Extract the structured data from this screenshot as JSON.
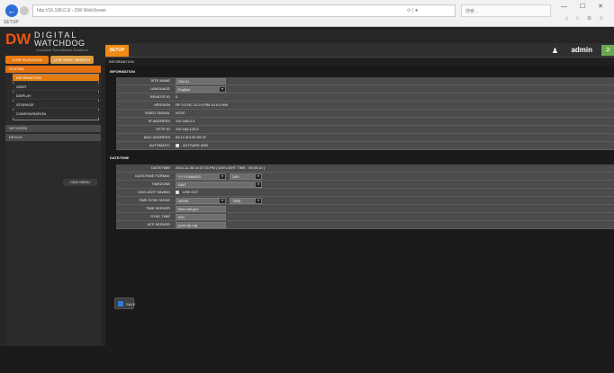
{
  "browser": {
    "address": "http://16.168.0.3/ - DW WebViewer",
    "addr_controls": "⟳ | ★",
    "search": "搜索...",
    "tab": "SETUP",
    "window_buttons": "— ☐ ✕",
    "tools": "⌂ ☆ ⚙ ☺"
  },
  "logo": {
    "mark": "DW",
    "line1": "DIGITAL",
    "line2": "WATCHDOG",
    "tagline": "Complete Surveillance Solutions"
  },
  "top": {
    "setup_tab": "SETUP",
    "user": "admin",
    "user_icon": "person-icon",
    "logout_icon": "exit-icon"
  },
  "left_tabs": [
    "CONFIGURATION",
    "LIVE VIEW / SEARCH"
  ],
  "sidebar": {
    "system": "SYSTEM",
    "items": [
      "INFORMATION",
      "USER",
      "DISPLAY",
      "STORAGE",
      "CONFIGURATION"
    ],
    "gray1": "NETWORK",
    "gray2": "DEVICE",
    "hide_menu": "HIDE MENU"
  },
  "main": {
    "breadcrumb": "INFORMATION",
    "info_title": "INFORMATION",
    "info_rows": [
      {
        "label": "SITE NAME",
        "value": "DW-01"
      },
      {
        "label": "LANGUAGE",
        "value": "English"
      },
      {
        "label": "REMOTE ID",
        "value": "0"
      },
      {
        "label": "VERSION",
        "value": "RF 0.0 RC 11.0.0 RM 16.0.0 HW"
      },
      {
        "label": "VIDEO SIGNAL",
        "value": "NTSC"
      },
      {
        "label": "IP ADDRESS",
        "value": "192.168.0.3"
      },
      {
        "label": "HTTP ID",
        "value": "192.168.123.5"
      },
      {
        "label": "MAC ADDRESS",
        "value": "00:1C:E3:2E:00:0F"
      },
      {
        "label": "AUTOMATIC",
        "value": "ACTIVATE ADD"
      }
    ],
    "datetime_title": "DATE/TIME",
    "datetime_rows": [
      {
        "label": "DATE/TIME",
        "value": "2014-11-06 14:07:15 PM ( DAYLIGHT TIME : 00:00:10 )"
      },
      {
        "label": "DATE/TIME FORMAT",
        "value": "YYYY/MM/DD",
        "value2": "24H"
      },
      {
        "label": "TIMEZONE",
        "value": "GMT"
      },
      {
        "label": "DAYLIGHT SAVING",
        "value": "USE DST"
      },
      {
        "label": "TIME SYNC MODE",
        "value": "NONE",
        "value2": "TIME"
      },
      {
        "label": "TIME SERVER",
        "value": "time.nist.gov"
      },
      {
        "label": "SYNC TIME",
        "value": "600"
      },
      {
        "label": "NTP SERVER",
        "value": "pool.ntp.org"
      }
    ],
    "save": "SAVE"
  }
}
